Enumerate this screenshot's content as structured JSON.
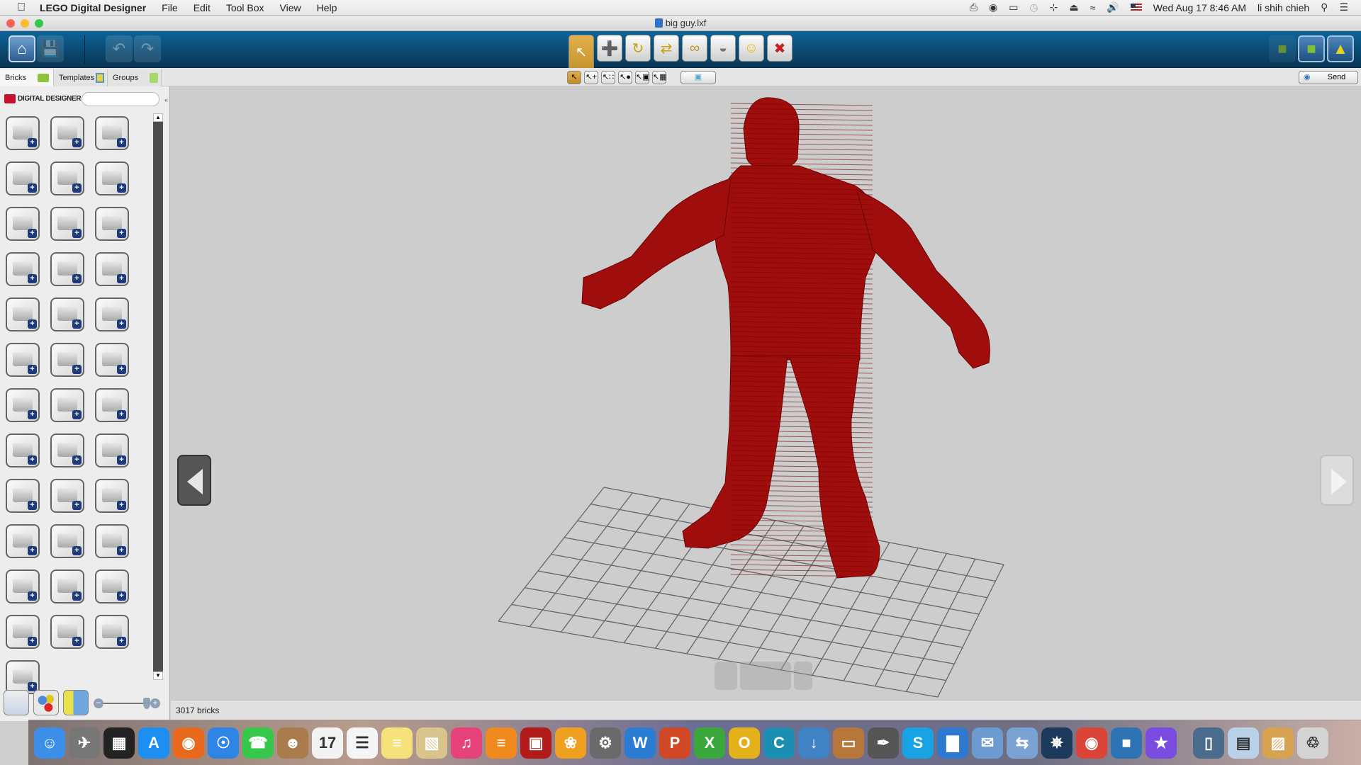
{
  "menubar": {
    "apple": "",
    "app_name": "LEGO Digital Designer",
    "menus": [
      "File",
      "Edit",
      "Tool Box",
      "View",
      "Help"
    ],
    "status_icons": [
      "printer-icon",
      "app-icon",
      "airplay-icon",
      "time-machine-icon",
      "bluetooth-icon",
      "eject-icon",
      "wifi-icon",
      "volume-icon",
      "flag-us-icon"
    ],
    "datetime": "Wed Aug 17  8:46 AM",
    "user": "li shih chieh"
  },
  "window": {
    "title": "big guy.lxf"
  },
  "toolbar": {
    "left_buttons": [
      "home-icon",
      "save-icon",
      "undo-icon",
      "redo-icon"
    ],
    "tools": [
      {
        "name": "select-tool",
        "glyph": "↖",
        "active": true
      },
      {
        "name": "clone-tool",
        "glyph": "➕"
      },
      {
        "name": "hinge-tool",
        "glyph": "↻"
      },
      {
        "name": "hinge-align-tool",
        "glyph": "⇄"
      },
      {
        "name": "flex-tool",
        "glyph": "∞"
      },
      {
        "name": "paint-tool",
        "glyph": "◒"
      },
      {
        "name": "decoration-tool",
        "glyph": "☺"
      },
      {
        "name": "delete-tool",
        "glyph": "✖"
      }
    ],
    "right_buttons": [
      "build-mode-icon",
      "view-mode-icon",
      "building-guide-icon"
    ]
  },
  "subbar": {
    "select_modes": [
      "↖",
      "↖+",
      "↖∷",
      "↖●",
      "↖▣",
      "↖▦"
    ],
    "invert_label": "▣",
    "send_label": "Send"
  },
  "tabs": [
    {
      "label": "Bricks",
      "active": true
    },
    {
      "label": "Templates"
    },
    {
      "label": "Groups"
    }
  ],
  "sidebar": {
    "brand": "DIGITAL DESIGNER",
    "search_placeholder": "",
    "brick_count_visible": 37,
    "zoom_slider_level": 0.9
  },
  "status": {
    "brick_count": "3017 bricks"
  },
  "dock": {
    "apps": [
      {
        "name": "finder",
        "glyph": "☺",
        "color": "#3b8fe8"
      },
      {
        "name": "launchpad",
        "glyph": "✈",
        "color": "#777"
      },
      {
        "name": "mission-control",
        "glyph": "▦",
        "color": "#222"
      },
      {
        "name": "app-store",
        "glyph": "A",
        "color": "#1d8ef2"
      },
      {
        "name": "firefox",
        "glyph": "◉",
        "color": "#e8691c"
      },
      {
        "name": "safari",
        "glyph": "☉",
        "color": "#2e85e6"
      },
      {
        "name": "facetime",
        "glyph": "☎",
        "color": "#35c84b"
      },
      {
        "name": "contacts",
        "glyph": "☻",
        "color": "#a97b4d"
      },
      {
        "name": "calendar",
        "glyph": "17",
        "color": "#f3f3f3"
      },
      {
        "name": "reminders",
        "glyph": "☰",
        "color": "#f5f5f5"
      },
      {
        "name": "notes",
        "glyph": "≡",
        "color": "#f6e27a"
      },
      {
        "name": "preview",
        "glyph": "▧",
        "color": "#d9c48c"
      },
      {
        "name": "itunes",
        "glyph": "♫",
        "color": "#e6437c"
      },
      {
        "name": "ibooks",
        "glyph": "≡",
        "color": "#f08a1c"
      },
      {
        "name": "photo-booth",
        "glyph": "▣",
        "color": "#b31b1b"
      },
      {
        "name": "photos",
        "glyph": "❀",
        "color": "#f0a020"
      },
      {
        "name": "system-preferences",
        "glyph": "⚙",
        "color": "#6a6a6a"
      },
      {
        "name": "word",
        "glyph": "W",
        "color": "#2b7cd3"
      },
      {
        "name": "powerpoint",
        "glyph": "P",
        "color": "#d24726"
      },
      {
        "name": "excel",
        "glyph": "X",
        "color": "#3aa83a"
      },
      {
        "name": "outlook",
        "glyph": "O",
        "color": "#e3b21b"
      },
      {
        "name": "c-app",
        "glyph": "C",
        "color": "#1a8fb3"
      },
      {
        "name": "downloader",
        "glyph": "↓",
        "color": "#3f83c4"
      },
      {
        "name": "keynote",
        "glyph": "▭",
        "color": "#b8773a"
      },
      {
        "name": "script-editor",
        "glyph": "✒",
        "color": "#555"
      },
      {
        "name": "skype",
        "glyph": "S",
        "color": "#18a4e4"
      },
      {
        "name": "numbers",
        "glyph": "▇",
        "color": "#2e7ad0"
      },
      {
        "name": "mail",
        "glyph": "✉",
        "color": "#6c9bd1"
      },
      {
        "name": "migration",
        "glyph": "⇆",
        "color": "#7aa3d4"
      },
      {
        "name": "battle-net",
        "glyph": "✵",
        "color": "#1b3a5c"
      },
      {
        "name": "chrome",
        "glyph": "◉",
        "color": "#db4437"
      },
      {
        "name": "lego-digital-designer",
        "glyph": "■",
        "color": "#2e74b5"
      },
      {
        "name": "imovie",
        "glyph": "★",
        "color": "#7b4ce0"
      },
      {
        "name": "iphone-backup",
        "glyph": "▯",
        "color": "#4a6c8c"
      },
      {
        "name": "documents-folder",
        "glyph": "▤",
        "color": "#b9d2ea"
      },
      {
        "name": "downloads-stack",
        "glyph": "▨",
        "color": "#d8a350"
      },
      {
        "name": "trash",
        "glyph": "♲",
        "color": "#d4d4d4"
      }
    ]
  }
}
